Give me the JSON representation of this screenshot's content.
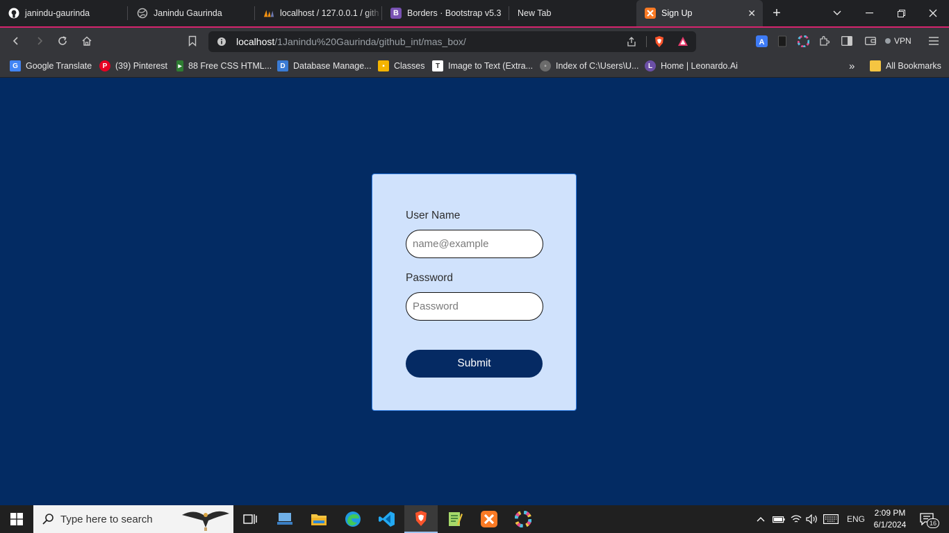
{
  "browser": {
    "tabs": [
      {
        "title": "janindu-gaurinda",
        "icon": "github-icon"
      },
      {
        "title": "Janindu Gaurinda",
        "icon": "globe-icon"
      },
      {
        "title": "localhost / 127.0.0.1 / gith",
        "icon": "phpmyadmin-icon"
      },
      {
        "title": "Borders · Bootstrap v5.3",
        "icon": "bootstrap-icon"
      },
      {
        "title": "New Tab",
        "icon": ""
      },
      {
        "title": "Sign Up",
        "icon": "xampp-icon"
      }
    ],
    "active_tab_close": "✕",
    "new_tab_label": "+",
    "url_host": "localhost",
    "url_path": "/1Janindu%20Gaurinda/github_int/mas_box/",
    "vpn_label": "VPN",
    "bookmarks": [
      {
        "label": "Google Translate",
        "icon": "google-translate-icon"
      },
      {
        "label": "(39) Pinterest",
        "icon": "pinterest-icon"
      },
      {
        "label": "88 Free CSS HTML...",
        "icon": "css-icon"
      },
      {
        "label": "Database Manage...",
        "icon": "database-icon"
      },
      {
        "label": "Classes",
        "icon": "classroom-icon"
      },
      {
        "label": "Image to Text (Extra...",
        "icon": "image-text-icon"
      },
      {
        "label": "Index of C:\\Users\\U...",
        "icon": "globe-icon"
      },
      {
        "label": "Home | Leonardo.Ai",
        "icon": "leonardo-icon"
      }
    ],
    "bookmarks_overflow": "»",
    "all_bookmarks": "All Bookmarks"
  },
  "form": {
    "username_label": "User Name",
    "username_placeholder": "name@example",
    "password_label": "Password",
    "password_placeholder": "Password",
    "submit_label": "Submit"
  },
  "taskbar": {
    "search_placeholder": "Type here to search",
    "language": "ENG",
    "time": "2:09 PM",
    "date": "6/1/2024",
    "notification_count": "16"
  },
  "colors": {
    "page_background": "#032b63",
    "card_background": "#d0e2fc",
    "submit_background": "#052a63",
    "tab_accent": "#d6246e"
  }
}
